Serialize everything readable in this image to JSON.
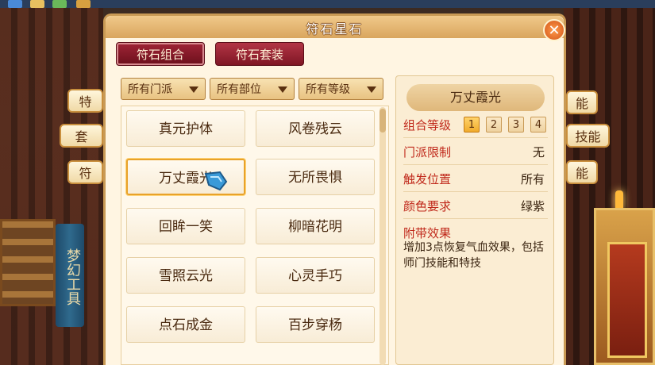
{
  "window": {
    "title": "符石星石"
  },
  "tabs": [
    {
      "label": "符石组合"
    },
    {
      "label": "符石套装"
    }
  ],
  "filters": [
    {
      "label": "所有门派"
    },
    {
      "label": "所有部位"
    },
    {
      "label": "所有等级"
    }
  ],
  "combos": [
    {
      "label": "真元护体"
    },
    {
      "label": "风卷残云"
    },
    {
      "label": "万丈霞光"
    },
    {
      "label": "无所畏惧"
    },
    {
      "label": "回眸一笑"
    },
    {
      "label": "柳暗花明"
    },
    {
      "label": "雪照云光"
    },
    {
      "label": "心灵手巧"
    },
    {
      "label": "点石成金"
    },
    {
      "label": "百步穿杨"
    }
  ],
  "details": {
    "name": "万丈霞光",
    "level_label": "组合等级",
    "levels": [
      "1",
      "2",
      "3",
      "4"
    ],
    "active_level": "1",
    "school_label": "门派限制",
    "school_value": "无",
    "position_label": "触发位置",
    "position_value": "所有",
    "color_label": "颜色要求",
    "color_value": "绿紫",
    "effect_label": "附带效果",
    "effect_text": "增加3点恢复气血效果，包括师门技能和特技"
  },
  "side_tabs": {
    "left": [
      "特",
      "套",
      "符"
    ],
    "right": [
      "能",
      "技能",
      "能"
    ],
    "banner": "梦幻工具"
  },
  "colors": {
    "panel_bg": "#fff5e2",
    "tab_red": "#8a1a28",
    "label_red": "#c0291b",
    "accent_gold": "#e8a22a"
  }
}
